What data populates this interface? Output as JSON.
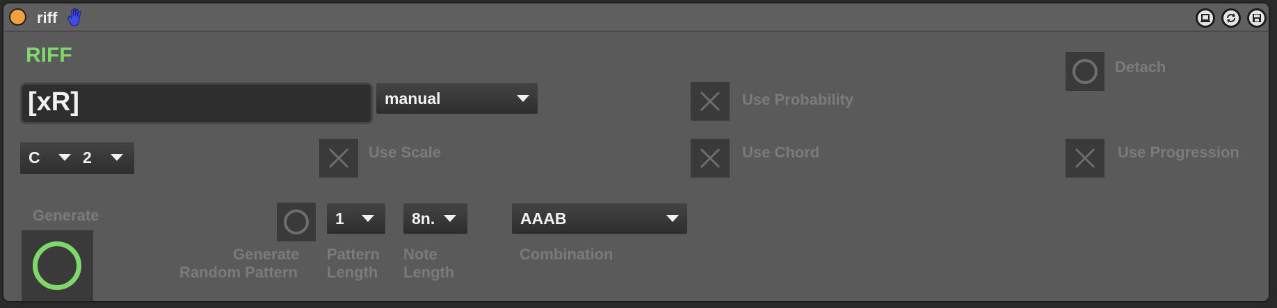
{
  "titlebar": {
    "title": "riff",
    "power_icon": "power-led-icon",
    "hand_icon": "hand-icon",
    "buttons": [
      "pin-icon",
      "refresh-icon",
      "save-icon"
    ]
  },
  "device": {
    "name_label": "RIFF",
    "riff_text": "[xR]",
    "mode": {
      "selected": "manual"
    },
    "key": {
      "selected": "C"
    },
    "octave": {
      "selected": "2"
    },
    "generate": {
      "label": "Generate"
    },
    "random_pattern": {
      "label_line1": "Generate",
      "label_line2": "Random Pattern"
    },
    "pattern_length": {
      "selected": "1",
      "label_line1": "Pattern",
      "label_line2": "Length"
    },
    "note_length": {
      "selected": "8n.",
      "label_line1": "Note",
      "label_line2": "Length"
    },
    "combination": {
      "selected": "AAAB",
      "label": "Combination"
    },
    "use_scale": {
      "label": "Use Scale",
      "checked": false
    },
    "use_probability": {
      "label": "Use Probability",
      "checked": false
    },
    "use_chord": {
      "label": "Use Chord",
      "checked": false
    },
    "use_progression": {
      "label": "Use Progression",
      "checked": false
    },
    "detach": {
      "label": "Detach"
    }
  },
  "colors": {
    "accent_green": "#7fd96a",
    "power_orange": "#f0a040",
    "hand_blue": "#3f4de0",
    "panel": "#5a5a5a",
    "dim_text": "#7b7b7b"
  }
}
